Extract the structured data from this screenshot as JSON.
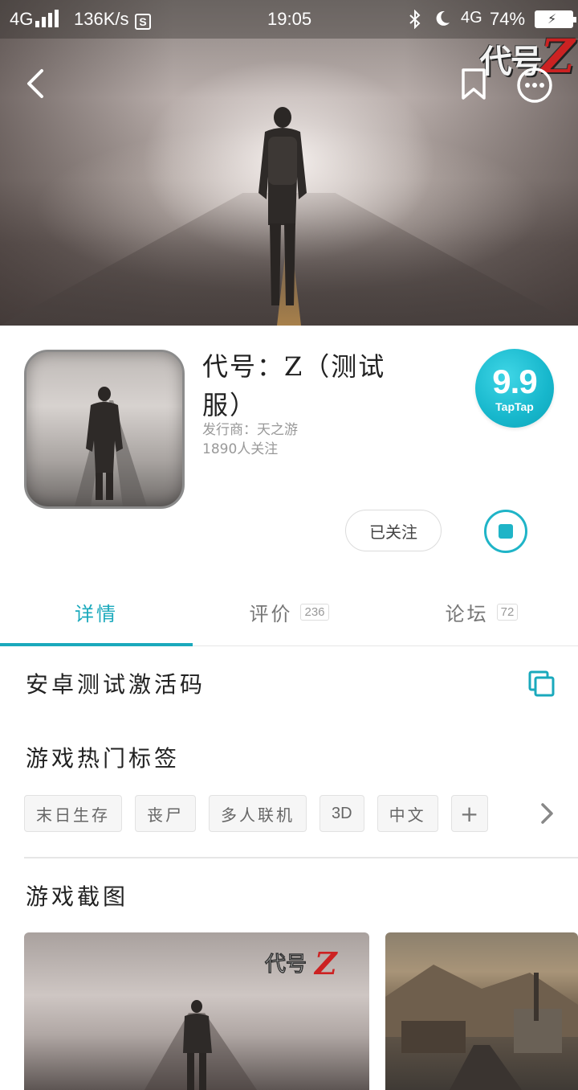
{
  "status_bar": {
    "network": "4G",
    "speed": "136K/s",
    "s_icon": "S",
    "time": "19:05",
    "network2": "4G",
    "battery": "74%"
  },
  "hero": {
    "logo_text": "代号",
    "logo_letter": "Z",
    "icons": [
      "back-icon",
      "bookmark-icon",
      "more-icon"
    ]
  },
  "app": {
    "title": "代号：Z（测试服）",
    "publisher": "发行商：天之游",
    "followers": "1890人关注",
    "rating": "9.9",
    "rating_brand": "TapTap",
    "follow_label": "已关注"
  },
  "tabs": [
    {
      "label": "详情",
      "count": ""
    },
    {
      "label": "评价",
      "count": "236"
    },
    {
      "label": "论坛",
      "count": "72"
    }
  ],
  "sections": {
    "activation": "安卓测试激活码",
    "hot_tags": "游戏热门标签",
    "screenshots": "游戏截图"
  },
  "tags": [
    "末日生存",
    "丧尸",
    "多人联机",
    "3D",
    "中文",
    "+"
  ],
  "colors": {
    "accent": "#1aa9bc",
    "rating_bg": "#17b7cc"
  }
}
